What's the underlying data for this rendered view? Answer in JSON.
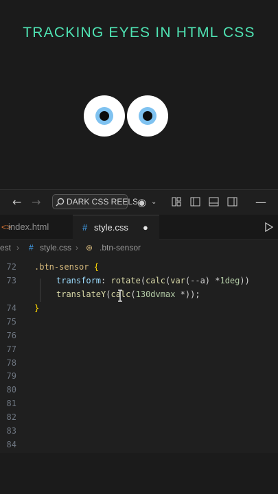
{
  "headline": "TRACKING EYES IN HTML CSS",
  "colors": {
    "accent": "#4fe3b3",
    "iris": "#7fc2f0"
  },
  "titlebar": {
    "search_label": "DARK CSS REELS",
    "icons": [
      "back-arrow-icon",
      "forward-arrow-icon",
      "search-icon",
      "copilot-icon",
      "chevron-down-icon",
      "layout-customize-icon",
      "toggle-sidebar-icon",
      "toggle-panel-icon",
      "toggle-secondary-sidebar-icon",
      "minimize-icon"
    ]
  },
  "tabs": [
    {
      "label": "index.html",
      "active": false
    },
    {
      "label": "style.css",
      "active": true,
      "modified": true
    }
  ],
  "breadcrumbs": [
    "est",
    "style.css",
    ".btn-sensor"
  ],
  "gutter": [
    "72",
    "73",
    "",
    "74",
    "75",
    "76",
    "77",
    "78",
    "79",
    "80",
    "81",
    "82",
    "83",
    "84"
  ],
  "code": {
    "l72_selector": ".btn-sensor",
    "l72_brace": " {",
    "l73_prop": "transform",
    "l73_rest1": ": ",
    "l73_fn1": "rotate",
    "l73_p1": "(",
    "l73_fn2": "calc",
    "l73_p2": "(",
    "l73_fn3": "var",
    "l73_p3": "(--a) *",
    "l73_num": "1deg",
    "l73_p4": "))",
    "l73b_fn": "translateY",
    "l73b_p1": "(",
    "l73b_fn2": "calc",
    "l73b_p2": "(",
    "l73b_num": "130dvmax",
    "l73b_p3": " *",
    "l73b_end": "));",
    "l74": "}"
  }
}
